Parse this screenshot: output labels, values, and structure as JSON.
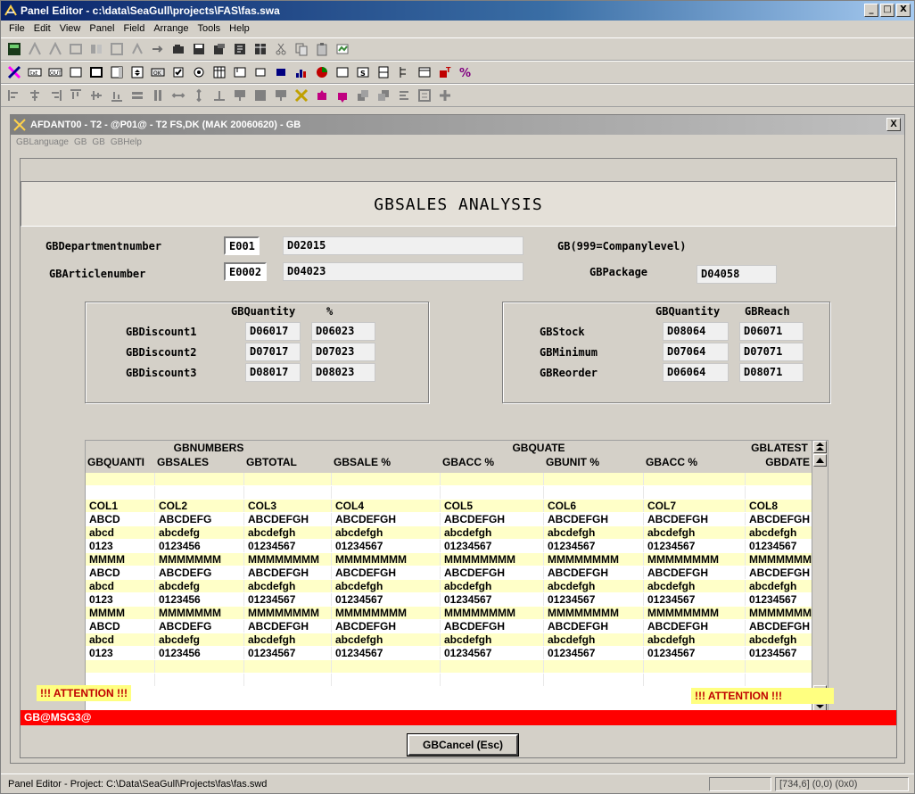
{
  "window": {
    "title": "Panel Editor - c:\\data\\SeaGull\\projects\\FAS\\fas.swa",
    "minimize": "_",
    "maximize": "□",
    "close": "X"
  },
  "menu": [
    "File",
    "Edit",
    "View",
    "Panel",
    "Field",
    "Arrange",
    "Tools",
    "Help"
  ],
  "child": {
    "title": "AFDANT00 - T2 - @P01@ - T2 FS,DK (MAK 20060620) - GB",
    "close": "X",
    "menu": [
      "GBLanguage",
      "GB",
      "GB",
      "GBHelp"
    ]
  },
  "panel": {
    "heading": "GBSALES ANALYSIS",
    "dept_label": "GBDepartmentnumber",
    "dept_code": "E001",
    "dept_value": "D02015",
    "company_note": "GB(999=Companylevel)",
    "article_label": "GBArticlenumber",
    "article_code": "E0002",
    "article_value": "D04023",
    "package_label": "GBPackage",
    "package_value": "D04058",
    "discount_box": {
      "col_qty": "GBQuantity",
      "col_pct": "%",
      "rows": [
        {
          "label": "GBDiscount1",
          "qty": "D06017",
          "pct": "D06023"
        },
        {
          "label": "GBDiscount2",
          "qty": "D07017",
          "pct": "D07023"
        },
        {
          "label": "GBDiscount3",
          "qty": "D08017",
          "pct": "D08023"
        }
      ]
    },
    "stock_box": {
      "col_qty": "GBQuantity",
      "col_reach": "GBReach",
      "rows": [
        {
          "label": "GBStock",
          "qty": "D08064",
          "reach": "D06071"
        },
        {
          "label": "GBMinimum",
          "qty": "D07064",
          "reach": "D07071"
        },
        {
          "label": "GBReorder",
          "qty": "D06064",
          "reach": "D08071"
        }
      ]
    },
    "grid": {
      "groups": [
        "GBNUMBERS",
        "GBQUATE",
        "GBLATEST"
      ],
      "columns": [
        "GBQUANTI",
        "GBSALES",
        "GBTOTAL",
        "GBSALE %",
        "GBACC %",
        "GBUNIT %",
        "GBACC %",
        "GBDATE"
      ],
      "rows": [
        [
          "",
          "",
          "",
          "",
          "",
          "",
          "",
          ""
        ],
        [
          "",
          "",
          "",
          "",
          "",
          "",
          "",
          ""
        ],
        [
          "COL1",
          "COL2",
          "COL3",
          "COL4",
          "COL5",
          "COL6",
          "COL7",
          "COL8"
        ],
        [
          "ABCD",
          "ABCDEFG",
          "ABCDEFGH",
          "ABCDEFGH",
          "ABCDEFGH",
          "ABCDEFGH",
          "ABCDEFGH",
          "ABCDEFGH"
        ],
        [
          "abcd",
          "abcdefg",
          "abcdefgh",
          "abcdefgh",
          "abcdefgh",
          "abcdefgh",
          "abcdefgh",
          "abcdefgh"
        ],
        [
          "0123",
          "0123456",
          "01234567",
          "01234567",
          "01234567",
          "01234567",
          "01234567",
          "01234567"
        ],
        [
          "MMMM",
          "MMMMMMM",
          "MMMMMMMM",
          "MMMMMMMM",
          "MMMMMMMM",
          "MMMMMMMM",
          "MMMMMMMM",
          "MMMMMMMM"
        ],
        [
          "ABCD",
          "ABCDEFG",
          "ABCDEFGH",
          "ABCDEFGH",
          "ABCDEFGH",
          "ABCDEFGH",
          "ABCDEFGH",
          "ABCDEFGH"
        ],
        [
          "abcd",
          "abcdefg",
          "abcdefgh",
          "abcdefgh",
          "abcdefgh",
          "abcdefgh",
          "abcdefgh",
          "abcdefgh"
        ],
        [
          "0123",
          "0123456",
          "01234567",
          "01234567",
          "01234567",
          "01234567",
          "01234567",
          "01234567"
        ],
        [
          "MMMM",
          "MMMMMMM",
          "MMMMMMMM",
          "MMMMMMMM",
          "MMMMMMMM",
          "MMMMMMMM",
          "MMMMMMMM",
          "MMMMMMMM"
        ],
        [
          "ABCD",
          "ABCDEFG",
          "ABCDEFGH",
          "ABCDEFGH",
          "ABCDEFGH",
          "ABCDEFGH",
          "ABCDEFGH",
          "ABCDEFGH"
        ],
        [
          "abcd",
          "abcdefg",
          "abcdefgh",
          "abcdefgh",
          "abcdefgh",
          "abcdefgh",
          "abcdefgh",
          "abcdefgh"
        ],
        [
          "0123",
          "0123456",
          "01234567",
          "01234567",
          "01234567",
          "01234567",
          "01234567",
          "01234567"
        ],
        [
          "",
          "",
          "",
          "",
          "",
          "",
          "",
          ""
        ],
        [
          "",
          "",
          "",
          "",
          "",
          "",
          "",
          ""
        ]
      ]
    },
    "attention_left": "!!! ATTENTION !!!",
    "attention_right": "!!! ATTENTION !!!",
    "message": "GB@MSG3@",
    "cancel_button": "GBCancel (Esc)"
  },
  "status": {
    "text": "Panel Editor - Project: C:\\Data\\SeaGull\\Projects\\fas\\fas.swd",
    "empty_pane": "",
    "coords": "[734,6] (0,0) (0x0)"
  },
  "colors": {
    "row_yellow": "#ffffc8",
    "message_red": "#ff0000",
    "attention_yellow": "#ffff80"
  }
}
